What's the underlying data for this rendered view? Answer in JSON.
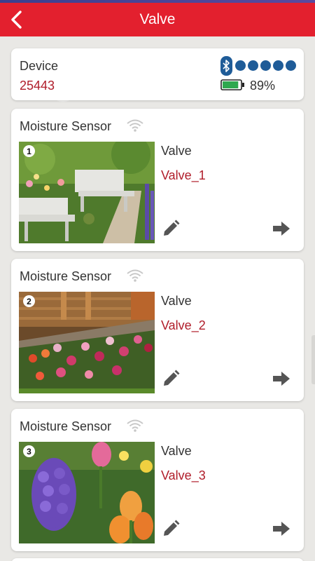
{
  "header": {
    "title": "Valve"
  },
  "device": {
    "label": "Device",
    "id": "25443",
    "battery_percent": "89%",
    "battery_level": 0.89,
    "signal_dots": 5,
    "icons": [
      "bluetooth-icon",
      "battery-icon"
    ]
  },
  "sensors": [
    {
      "number": "1",
      "title": "Moisture Sensor",
      "valve_label": "Valve",
      "valve_name": "Valve_1",
      "photo": "garden-bench-photo"
    },
    {
      "number": "2",
      "title": "Moisture Sensor",
      "valve_label": "Valve",
      "valve_name": "Valve_2",
      "photo": "flower-bed-photo"
    },
    {
      "number": "3",
      "title": "Moisture Sensor",
      "valve_label": "Valve",
      "valve_name": "Valve_3",
      "photo": "hyacinth-tulips-photo"
    }
  ],
  "colors": {
    "header_red": "#e3202e",
    "accent_dark_red": "#b01d2a",
    "bluetooth_blue": "#1f5c98",
    "battery_green": "#2fa84f"
  }
}
